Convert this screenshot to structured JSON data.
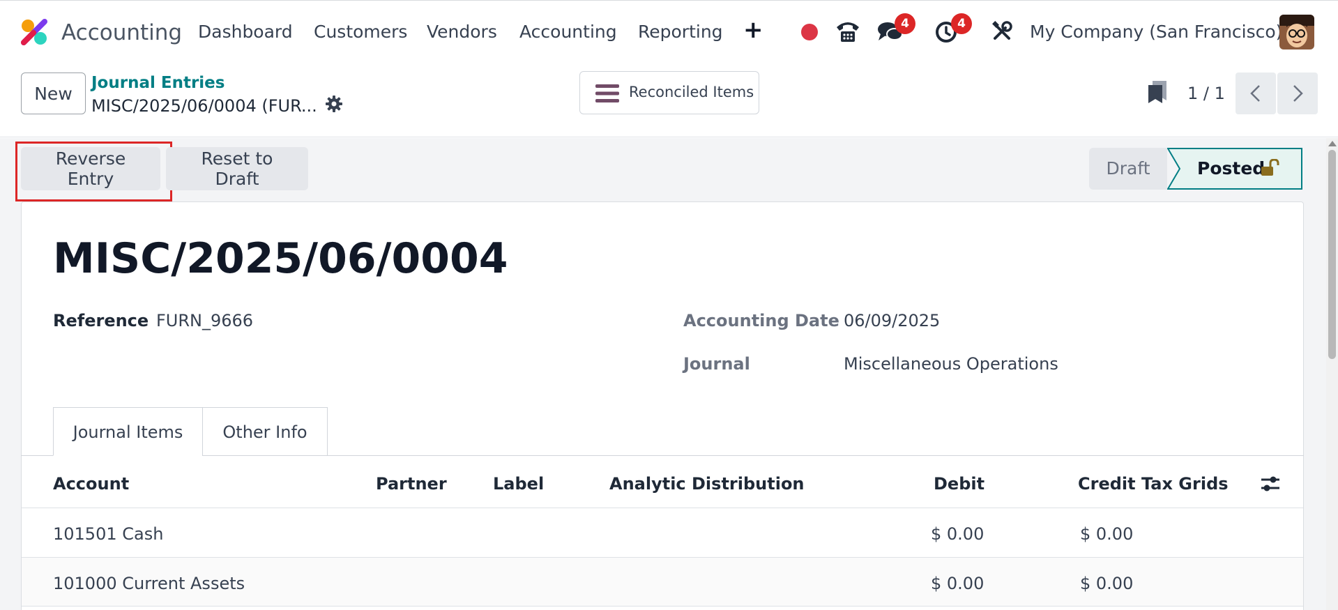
{
  "navbar": {
    "app_name": "Accounting",
    "menu": [
      "Dashboard",
      "Customers",
      "Vendors",
      "Accounting",
      "Reporting"
    ],
    "plus": "+",
    "messages_count": "4",
    "activities_count": "4",
    "company": "My Company (San Francisco)",
    "icons": [
      "app-logo",
      "record-dot-icon",
      "phone-icon",
      "chat-icon",
      "clock-icon",
      "tools-icon",
      "avatar"
    ]
  },
  "control": {
    "new_label": "New",
    "breadcrumb_parent": "Journal Entries",
    "breadcrumb_current": "MISC/2025/06/0004 (FUR...",
    "reconciled_label": "Reconciled Items",
    "pager": "1 / 1"
  },
  "actions": {
    "reverse_entry": "Reverse Entry",
    "reset_to_draft": "Reset to Draft"
  },
  "status": {
    "draft": "Draft",
    "posted": "Posted",
    "active": "Posted"
  },
  "form": {
    "title": "MISC/2025/06/0004",
    "reference_label": "Reference",
    "reference_value": "FURN_9666",
    "date_label": "Accounting Date",
    "date_value": "06/09/2025",
    "journal_label": "Journal",
    "journal_value": "Miscellaneous Operations"
  },
  "tabs": [
    {
      "label": "Journal Items",
      "active": true
    },
    {
      "label": "Other Info",
      "active": false
    }
  ],
  "table": {
    "headers": {
      "account": "Account",
      "partner": "Partner",
      "label": "Label",
      "analytic": "Analytic Distribution",
      "debit": "Debit",
      "credit": "Credit",
      "tax_grids": "Tax Grids"
    },
    "rows": [
      {
        "account": "101501 Cash",
        "partner": "",
        "label": "",
        "analytic": "",
        "debit": "$ 0.00",
        "credit": "$ 0.00",
        "tax_grids": ""
      },
      {
        "account": "101000 Current Assets",
        "partner": "",
        "label": "",
        "analytic": "",
        "debit": "$ 0.00",
        "credit": "$ 0.00",
        "tax_grids": ""
      }
    ]
  },
  "colors": {
    "brand_teal": "#017e84",
    "badge_red": "#dc2626",
    "highlight_red": "#dc2626",
    "lock_gold": "#8a6d1e"
  }
}
